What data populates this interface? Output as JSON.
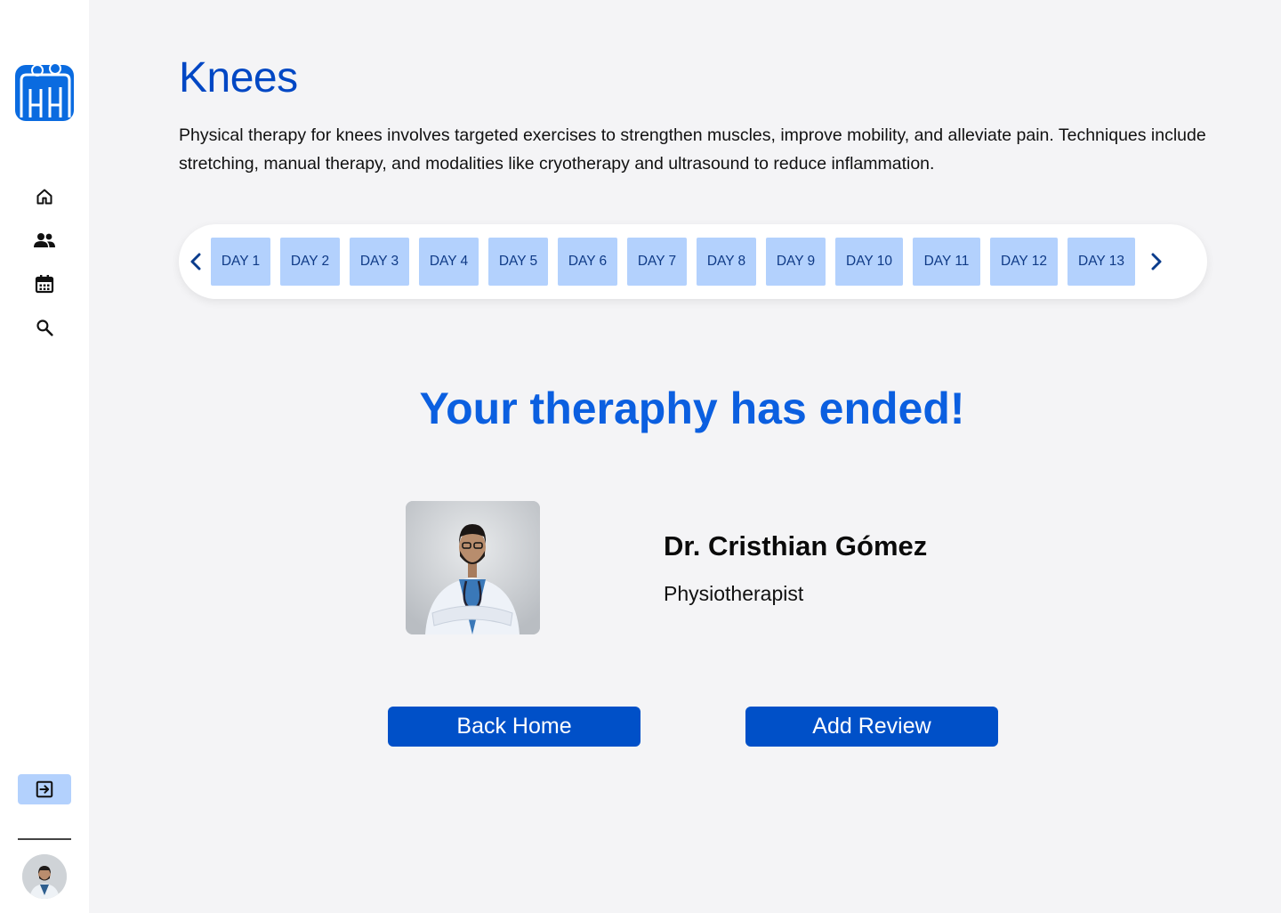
{
  "sidebar": {
    "nav_icons": [
      "home-icon",
      "people-icon",
      "calendar-icon",
      "search-icon"
    ],
    "logout_icon": "logout-icon"
  },
  "main": {
    "title": "Knees",
    "description": "Physical therapy for knees involves targeted exercises to strengthen muscles, improve mobility, and alleviate pain. Techniques include stretching, manual therapy, and modalities like cryotherapy and ultrasound to reduce inflammation.",
    "days": [
      "DAY 1",
      "DAY 2",
      "DAY 3",
      "DAY 4",
      "DAY 5",
      "DAY 6",
      "DAY 7",
      "DAY 8",
      "DAY 9",
      "DAY 10",
      "DAY 11",
      "DAY 12",
      "DAY 13"
    ],
    "ended_heading": "Your theraphy has ended!",
    "doctor": {
      "name": "Dr. Cristhian Gómez",
      "role": "Physiotherapist"
    },
    "buttons": {
      "back_home": "Back Home",
      "add_review": "Add Review"
    }
  },
  "colors": {
    "primary": "#0050c8",
    "title": "#0047c4",
    "heading": "#0b5fe0",
    "pill": "#b3d1fd",
    "pill_text": "#0f3a86",
    "background": "#f4f4f6"
  }
}
